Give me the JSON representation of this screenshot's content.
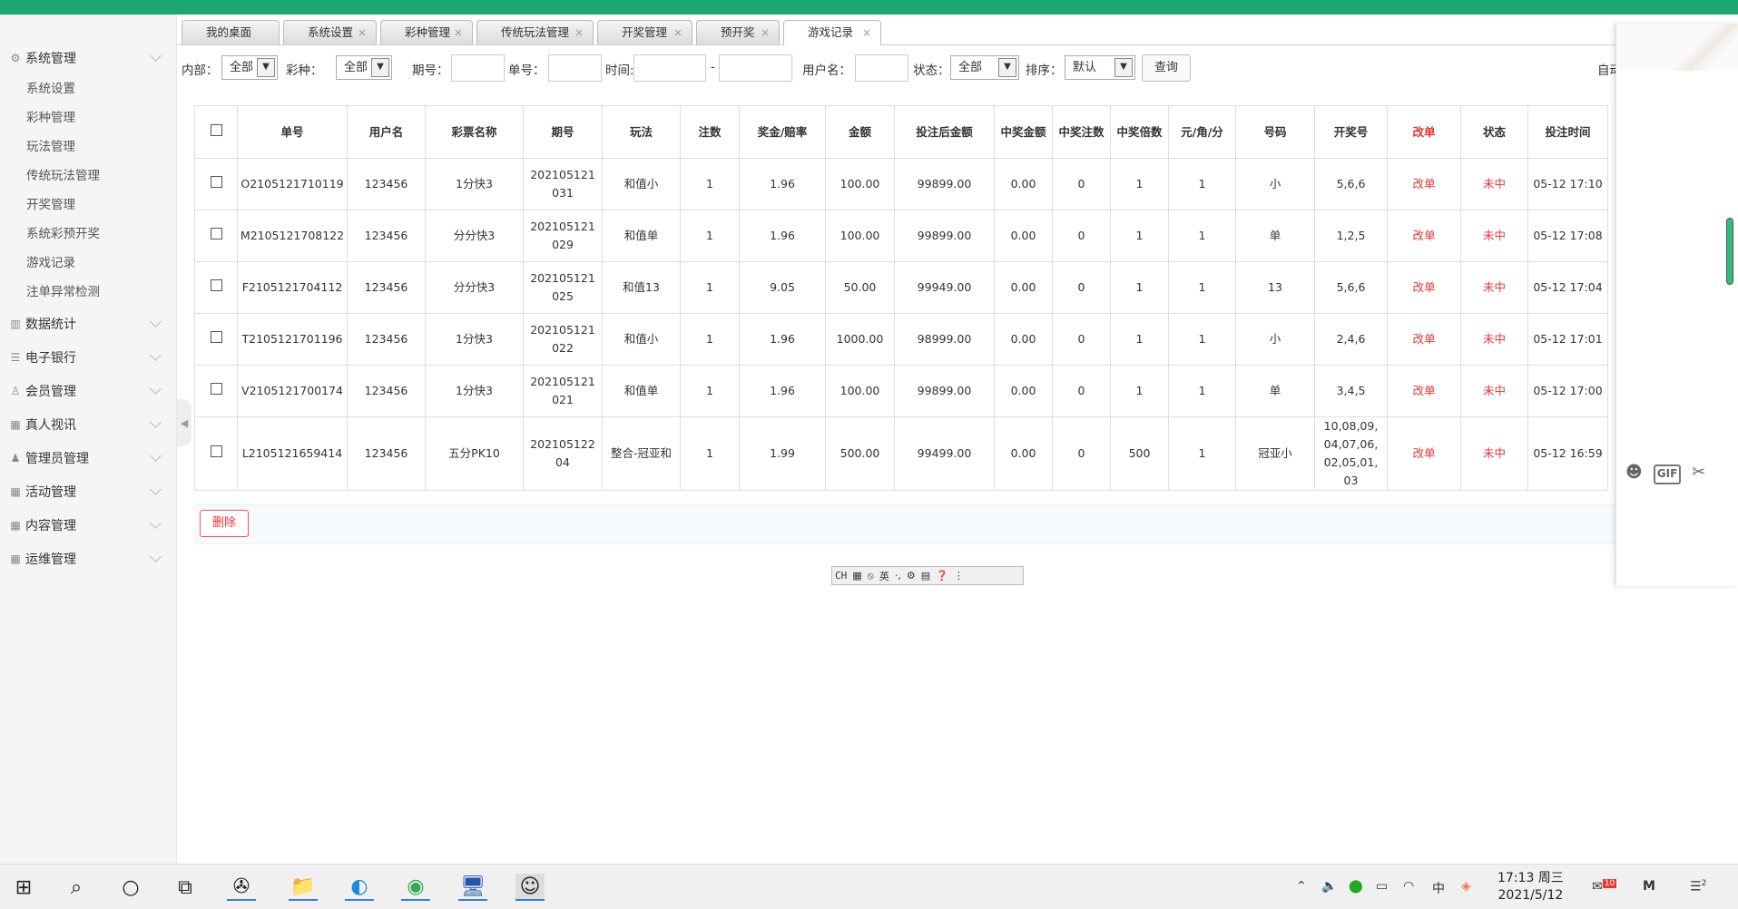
{
  "tabs": [
    {
      "label": "我的桌面",
      "closable": false
    },
    {
      "label": "系统设置",
      "closable": true
    },
    {
      "label": "彩种管理",
      "closable": true
    },
    {
      "label": "传统玩法管理",
      "closable": true
    },
    {
      "label": "开奖管理",
      "closable": true
    },
    {
      "label": "预开奖",
      "closable": true
    },
    {
      "label": "游戏记录",
      "closable": true,
      "active": true
    }
  ],
  "sidebar": {
    "sections": [
      {
        "label": "系统管理",
        "icon": "gear-icon",
        "expanded": true,
        "items": [
          "系统设置",
          "彩种管理",
          "玩法管理",
          "传统玩法管理",
          "开奖管理",
          "系统彩预开奖",
          "游戏记录",
          "注单异常检测"
        ]
      },
      {
        "label": "数据统计",
        "icon": "chart-icon"
      },
      {
        "label": "电子银行",
        "icon": "list-icon"
      },
      {
        "label": "会员管理",
        "icon": "user-icon"
      },
      {
        "label": "真人视讯",
        "icon": "grid-icon"
      },
      {
        "label": "管理员管理",
        "icon": "admin-icon"
      },
      {
        "label": "活动管理",
        "icon": "grid-icon"
      },
      {
        "label": "内容管理",
        "icon": "grid-icon"
      },
      {
        "label": "运维管理",
        "icon": "grid-icon"
      }
    ]
  },
  "filter": {
    "internal_label": "内部：",
    "internal_value": "全部",
    "lottery_label": "彩种：",
    "lottery_value": "全部",
    "period_label": "期号：",
    "order_label": "单号：",
    "time_label": "时间:",
    "time_sep": "-",
    "user_label": "用户名：",
    "status_label": "状态：",
    "status_value": "全部",
    "sort_label": "排序：",
    "sort_value": "默认",
    "query_button": "查询",
    "right_cut": "自动"
  },
  "table": {
    "headers": [
      "单号",
      "用户名",
      "彩票名称",
      "期号",
      "玩法",
      "注数",
      "奖金/赔率",
      "金额",
      "投注后金额",
      "中奖金额",
      "中奖注数",
      "中奖倍数",
      "元/角/分",
      "号码",
      "开奖号",
      "改单",
      "状态",
      "投注时间"
    ],
    "rows": [
      [
        "O2105121710119",
        "123456",
        "1分快3",
        "202105121031",
        "和值小",
        "1",
        "1.96",
        "100.00",
        "99899.00",
        "0.00",
        "0",
        "1",
        "1",
        "小",
        "5,6,6",
        "改单",
        "未中",
        "05-12 17:10"
      ],
      [
        "M2105121708122",
        "123456",
        "分分快3",
        "202105121029",
        "和值单",
        "1",
        "1.96",
        "100.00",
        "99899.00",
        "0.00",
        "0",
        "1",
        "1",
        "单",
        "1,2,5",
        "改单",
        "未中",
        "05-12 17:08"
      ],
      [
        "F2105121704112",
        "123456",
        "分分快3",
        "202105121025",
        "和值13",
        "1",
        "9.05",
        "50.00",
        "99949.00",
        "0.00",
        "0",
        "1",
        "1",
        "13",
        "5,6,6",
        "改单",
        "未中",
        "05-12 17:04"
      ],
      [
        "T2105121701196",
        "123456",
        "1分快3",
        "202105121022",
        "和值小",
        "1",
        "1.96",
        "1000.00",
        "98999.00",
        "0.00",
        "0",
        "1",
        "1",
        "小",
        "2,4,6",
        "改单",
        "未中",
        "05-12 17:01"
      ],
      [
        "V2105121700174",
        "123456",
        "1分快3",
        "202105121021",
        "和值单",
        "1",
        "1.96",
        "100.00",
        "99899.00",
        "0.00",
        "0",
        "1",
        "1",
        "单",
        "3,4,5",
        "改单",
        "未中",
        "05-12 17:00"
      ],
      [
        "L2105121659414",
        "123456",
        "五分PK10",
        "20210512204",
        "整合-冠亚和",
        "1",
        "1.99",
        "500.00",
        "99499.00",
        "0.00",
        "0",
        "500",
        "1",
        "冠亚小",
        "10,08,09,04,07,06,02,05,01,03",
        "改单",
        "未中",
        "05-12 16:59"
      ]
    ]
  },
  "delete_button": "删除",
  "ime": {
    "mode": "CH",
    "lang": "英"
  },
  "chat": {
    "gif_label": "GIF"
  },
  "taskbar": {
    "time": "17:13 周三",
    "date": "2021/5/12",
    "ime_tray": "中",
    "mail_badge": "10",
    "notif_badge": "2"
  },
  "colors": {
    "brand_green": "#1ba672",
    "alert_red": "#e53333"
  }
}
